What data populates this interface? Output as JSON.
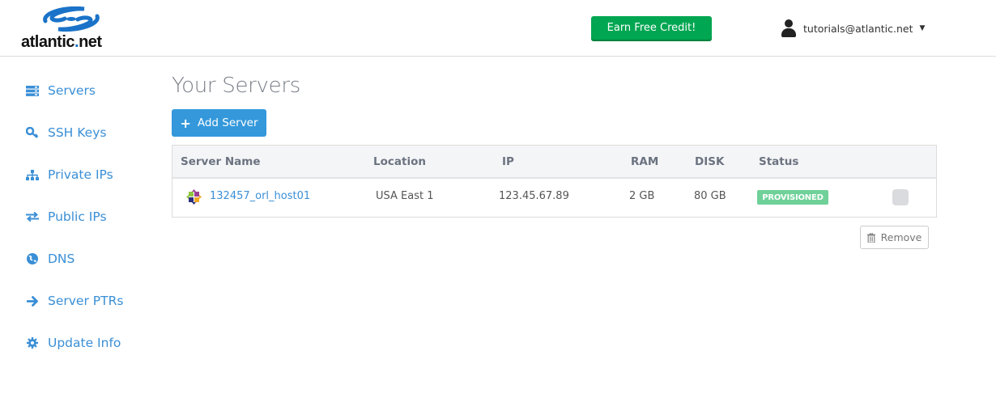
{
  "header": {
    "logo_text_main": "atlantic",
    "logo_text_dot": ".",
    "logo_text_tail": "net",
    "credit_button": "Earn Free Credit!",
    "user_email": "tutorials@atlantic.net",
    "user_caret": "▼"
  },
  "sidebar": {
    "items": [
      {
        "label": "Servers",
        "icon": "servers-icon"
      },
      {
        "label": "SSH Keys",
        "icon": "key-icon"
      },
      {
        "label": "Private IPs",
        "icon": "sitemap-icon"
      },
      {
        "label": "Public IPs",
        "icon": "exchange-icon"
      },
      {
        "label": "DNS",
        "icon": "globe-icon"
      },
      {
        "label": "Server PTRs",
        "icon": "arrow-right-icon"
      },
      {
        "label": "Update Info",
        "icon": "gear-icon"
      }
    ]
  },
  "main": {
    "title": "Your Servers",
    "add_button": "Add Server",
    "add_button_icon": "+",
    "table": {
      "columns": [
        "Server Name",
        "Location",
        "IP",
        "RAM",
        "DISK",
        "Status"
      ],
      "rows": [
        {
          "name": "132457_orl_host01",
          "os_icon": "centos-icon",
          "location": "USA East 1",
          "ip": "123.45.67.89",
          "ram": "2 GB",
          "disk": "80 GB",
          "status": "PROVISIONED",
          "selected": false
        }
      ]
    },
    "remove_button": "Remove"
  },
  "colors": {
    "accent": "#3a8fd6",
    "add_button": "#3498db",
    "credit_button": "#00a651",
    "status_provisioned": "#6fd199"
  }
}
